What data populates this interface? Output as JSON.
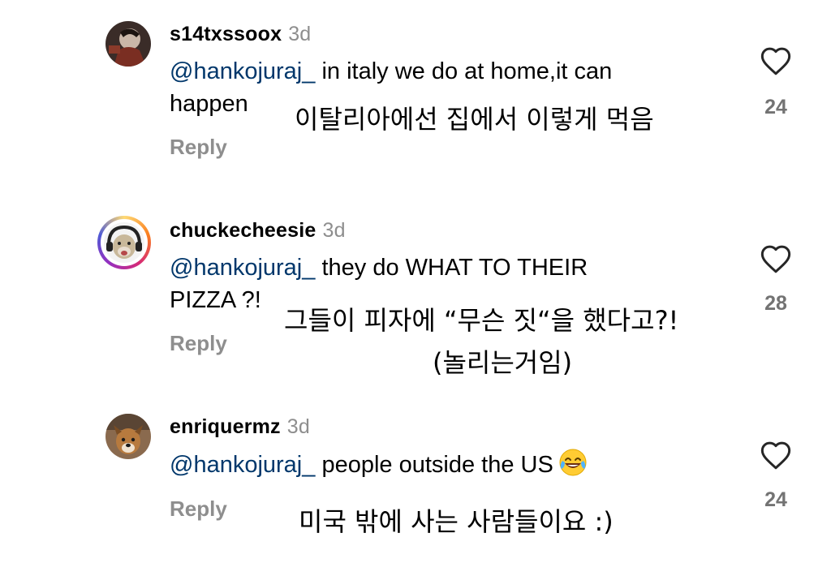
{
  "comments": [
    {
      "username": "s14txssoox",
      "time": "3d",
      "mention": "@hankojuraj_",
      "text_line1": " in italy we do at home,it can",
      "text_line2": "happen",
      "translation": "이탈리아에선 집에서 이렇게 먹음",
      "reply_label": "Reply",
      "like_count": "24",
      "like_icon": "heart-outline-icon"
    },
    {
      "username": "chuckecheesie",
      "time": "3d",
      "mention": "@hankojuraj_",
      "text_line1": " they do WHAT TO THEIR",
      "text_line2": "PIZZA ?!",
      "translation_line1": "그들이 피자에 “무슨 짓“을 했다고?!",
      "translation_line2": "(놀리는거임)",
      "reply_label": "Reply",
      "like_count": "28",
      "like_icon": "heart-outline-icon"
    },
    {
      "username": "enriquermz",
      "time": "3d",
      "mention": "@hankojuraj_",
      "text_line1": " people outside the US",
      "emoji": "face-with-tears-of-joy",
      "translation": "미국 밖에 사는 사람들이요 :)",
      "reply_label": "Reply",
      "like_count": "24",
      "like_icon": "heart-outline-icon"
    }
  ],
  "colors": {
    "mention": "#00376b",
    "secondary_text": "#8e8e8e",
    "like_count": "#737373",
    "background": "#ffffff"
  }
}
